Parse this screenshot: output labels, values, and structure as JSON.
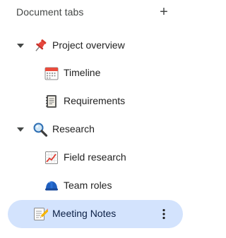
{
  "header": {
    "title": "Document tabs",
    "add_label": "+"
  },
  "tabs": [
    {
      "label": "Project overview",
      "icon": "pushpin-icon",
      "expanded": true,
      "level": 0
    },
    {
      "label": "Timeline",
      "icon": "calendar-icon",
      "level": 1
    },
    {
      "label": "Requirements",
      "icon": "ledger-icon",
      "level": 1
    },
    {
      "label": "Research",
      "icon": "magnifier-icon",
      "expanded": true,
      "level": 0
    },
    {
      "label": "Field research",
      "icon": "chart-increasing-icon",
      "level": 1
    },
    {
      "label": "Team roles",
      "icon": "helmet-icon",
      "level": 1
    },
    {
      "label": "Meeting Notes",
      "icon": "memo-icon",
      "level": 0,
      "selected": true
    }
  ],
  "colors": {
    "selected_bg": "#d3e3fd",
    "text": "#1f1f1f",
    "muted": "#444746"
  }
}
